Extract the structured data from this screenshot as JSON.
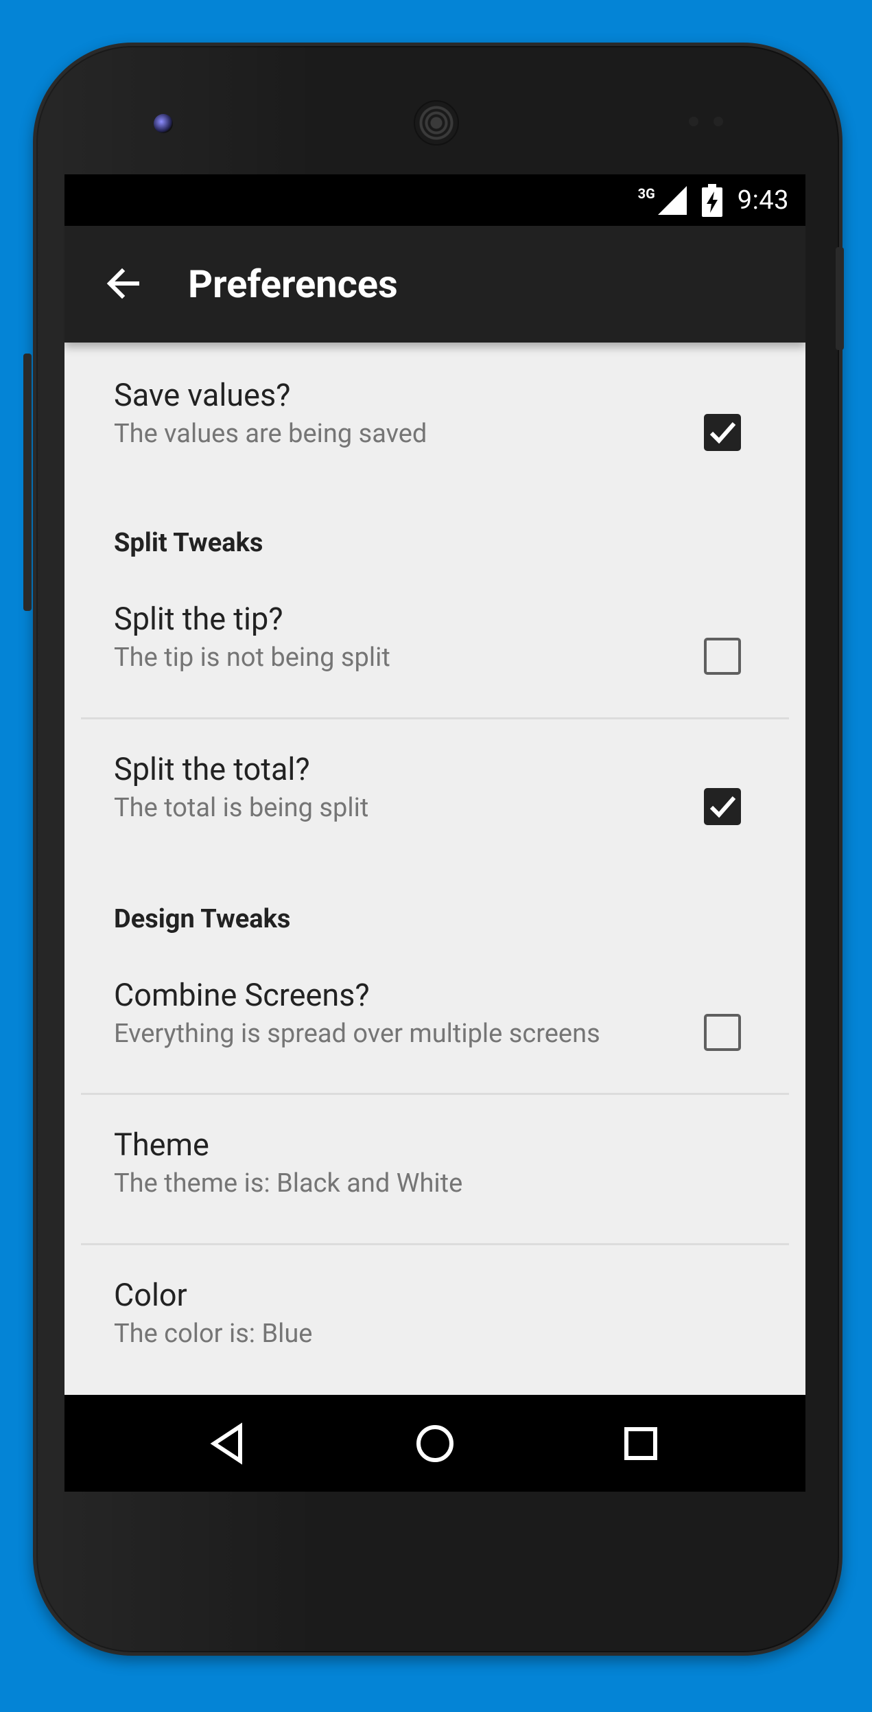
{
  "status_bar": {
    "network_label": "3G",
    "time": "9:43",
    "icons": [
      "signal-icon",
      "battery-charging-icon"
    ]
  },
  "app_bar": {
    "title": "Preferences",
    "back_icon": "arrow-left-icon"
  },
  "preferences": {
    "save_values": {
      "title": "Save values?",
      "summary": "The values are being saved",
      "checked": true
    },
    "split_category": "Split Tweaks",
    "split_tip": {
      "title": "Split the tip?",
      "summary": "The tip is not being split",
      "checked": false
    },
    "split_total": {
      "title": "Split the total?",
      "summary": "The total is being split",
      "checked": true
    },
    "design_category": "Design Tweaks",
    "combine_screens": {
      "title": "Combine Screens?",
      "summary": "Everything is spread over multiple screens",
      "checked": false
    },
    "theme": {
      "title": "Theme",
      "summary": "The theme is: Black and White"
    },
    "color": {
      "title": "Color",
      "summary": "The color is: Blue"
    }
  },
  "navigation": {
    "back": "nav-back-icon",
    "home": "nav-home-icon",
    "recents": "nav-recents-icon"
  },
  "colors": {
    "background": "#0484D6",
    "device_body": "#1B1B1B",
    "screen_background": "#EFEFEF",
    "app_bar": "#212121",
    "status_bar": "#000000",
    "checkbox": "#222222"
  }
}
